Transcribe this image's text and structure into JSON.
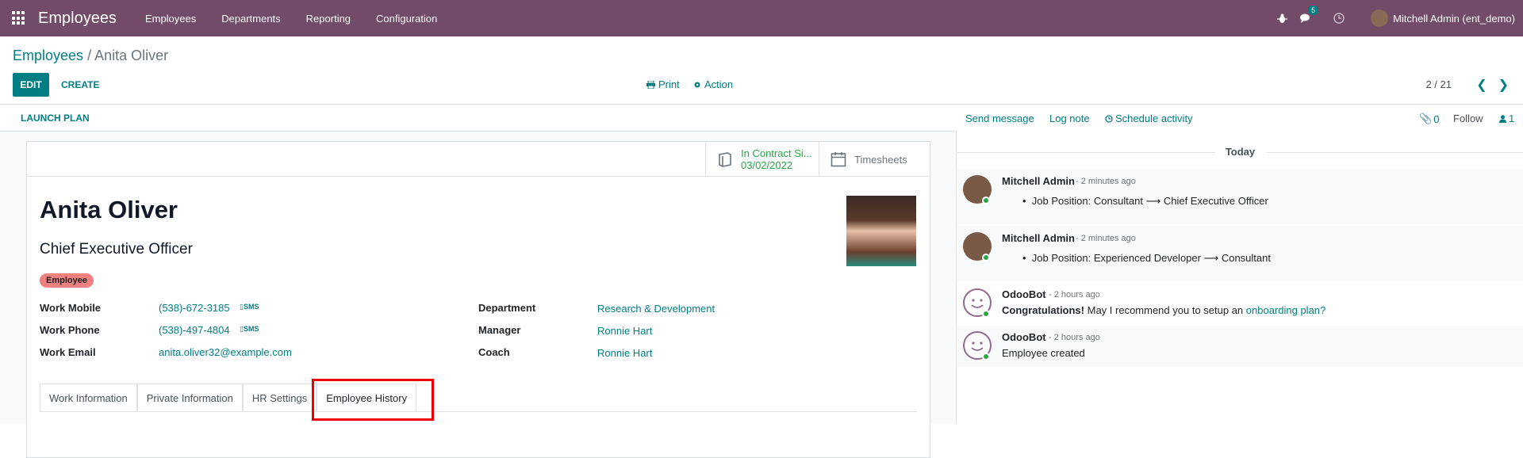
{
  "navbar": {
    "brand": "Employees",
    "menu": [
      "Employees",
      "Departments",
      "Reporting",
      "Configuration"
    ],
    "chat_count": "5",
    "user": "Mitchell Admin (ent_demo)"
  },
  "control_panel": {
    "breadcrumb_parent": "Employees",
    "breadcrumb_sep": "/",
    "breadcrumb_current": "Anita Oliver",
    "edit_label": "EDIT",
    "create_label": "CREATE",
    "print_label": "Print",
    "action_label": "Action",
    "pager": "2 / 21"
  },
  "statusbar": {
    "launch_plan": "LAUNCH PLAN"
  },
  "smart_buttons": {
    "contract_line1": "In Contract Si...",
    "contract_line2": "03/02/2022",
    "timesheets": "Timesheets"
  },
  "employee": {
    "name": "Anita Oliver",
    "job_title": "Chief Executive Officer",
    "tag": "Employee"
  },
  "fields_left": [
    {
      "label": "Work Mobile",
      "value": "(538)-672-3185",
      "sms": "SMS"
    },
    {
      "label": "Work Phone",
      "value": "(538)-497-4804",
      "sms": "SMS"
    },
    {
      "label": "Work Email",
      "value": "anita.oliver32@example.com",
      "sms": ""
    }
  ],
  "fields_right": [
    {
      "label": "Department",
      "value": "Research & Development"
    },
    {
      "label": "Manager",
      "value": "Ronnie Hart"
    },
    {
      "label": "Coach",
      "value": "Ronnie Hart"
    }
  ],
  "tabs": [
    "Work Information",
    "Private Information",
    "HR Settings",
    "Employee History"
  ],
  "chatter": {
    "send_message": "Send message",
    "log_note": "Log note",
    "schedule_activity": "Schedule activity",
    "attachments": "0",
    "follow": "Follow",
    "followers": "1",
    "today": "Today",
    "messages": [
      {
        "author": "Mitchell Admin",
        "time": "- 2 minutes ago",
        "body": "Job Position: Consultant ⟶ Chief Executive Officer"
      },
      {
        "author": "Mitchell Admin",
        "time": "- 2 minutes ago",
        "body": "Job Position: Experienced Developer ⟶ Consultant"
      },
      {
        "author": "OdooBot",
        "time": "- 2 hours ago",
        "body_bold": "Congratulations!",
        "body_rest": " May I recommend you to setup an ",
        "body_link": "onboarding plan?"
      },
      {
        "author": "OdooBot",
        "time": "- 2 hours ago",
        "body": "Employee created"
      }
    ]
  }
}
